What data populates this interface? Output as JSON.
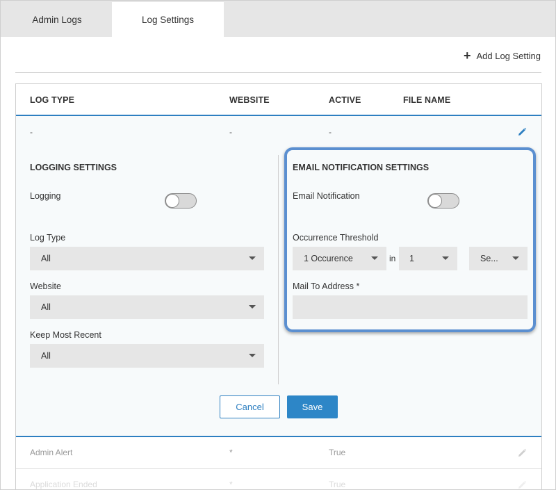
{
  "tabs": [
    {
      "label": "Admin Logs",
      "active": false
    },
    {
      "label": "Log Settings",
      "active": true
    }
  ],
  "toolbar": {
    "add_label": "Add Log Setting",
    "add_icon": "plus-icon"
  },
  "table": {
    "columns": [
      "LOG TYPE",
      "WEBSITE",
      "ACTIVE",
      "FILE NAME"
    ],
    "expanded_row": {
      "log_type": "-",
      "website": "-",
      "active": "-",
      "file_name": ""
    },
    "rows": [
      {
        "log_type": "Admin Alert",
        "website": "*",
        "active": "True",
        "file_name": ""
      },
      {
        "log_type": "Application Ended",
        "website": "*",
        "active": "True",
        "file_name": ""
      }
    ]
  },
  "logging": {
    "title": "LOGGING SETTINGS",
    "logging_label": "Logging",
    "logging_enabled": false,
    "log_type_label": "Log Type",
    "log_type_value": "All",
    "website_label": "Website",
    "website_value": "All",
    "keep_label": "Keep Most Recent",
    "keep_value": "All"
  },
  "email": {
    "title": "EMAIL NOTIFICATION SETTINGS",
    "notification_label": "Email Notification",
    "notification_enabled": false,
    "threshold_label": "Occurrence Threshold",
    "occurrence_value": "1 Occurence",
    "in_label": "in",
    "count_value": "1",
    "unit_value": "Se...",
    "mail_label": "Mail To Address *",
    "mail_value": ""
  },
  "actions": {
    "cancel": "Cancel",
    "save": "Save"
  },
  "colors": {
    "accent": "#2d7fc1",
    "highlight": "#5b8fd0",
    "tab_bg": "#e6e6e6"
  }
}
